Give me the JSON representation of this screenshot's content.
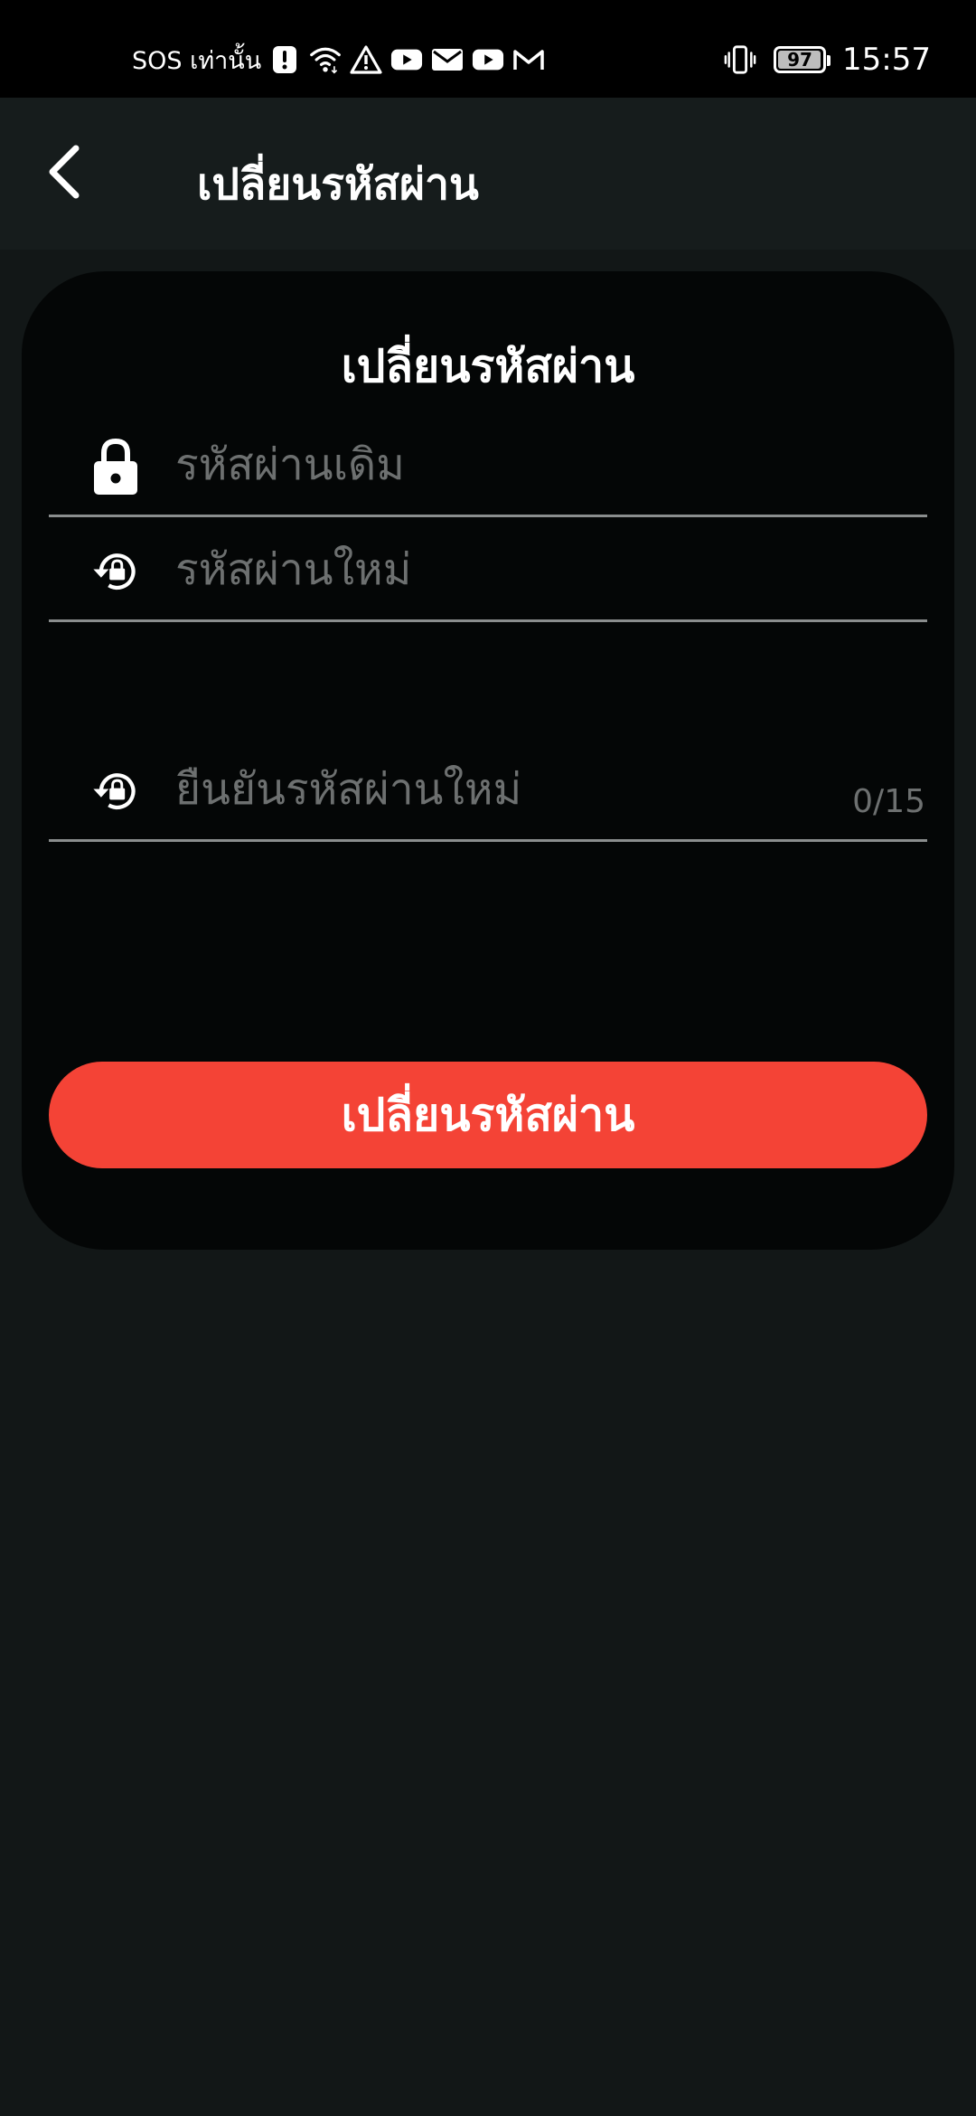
{
  "status_bar": {
    "carrier_text": "SOS เท่านั้น",
    "icons": [
      "alert-badge-icon",
      "wifi-icon",
      "warning-icon",
      "youtube-icon",
      "mail-icon",
      "youtube-icon",
      "gmail-icon"
    ],
    "vibrate_icon": "vibrate-icon",
    "battery_level": "97",
    "time": "15:57"
  },
  "header": {
    "back_icon": "chevron-left-icon",
    "title": "เปลี่ยนรหัสผ่าน"
  },
  "form": {
    "title": "เปลี่ยนรหัสผ่าน",
    "fields": [
      {
        "icon": "lock-icon",
        "placeholder": "รหัสผ่านเดิม",
        "value": ""
      },
      {
        "icon": "lock-reset-icon",
        "placeholder": "รหัสผ่านใหม่",
        "value": ""
      },
      {
        "icon": "lock-reset-icon",
        "placeholder": "ยืนยันรหัสผ่านใหม่",
        "value": ""
      }
    ],
    "new_password_counter": "0/15",
    "submit_label": "เปลี่ยนรหัสผ่าน"
  },
  "colors": {
    "accent": "#f44336",
    "background": "#121717",
    "card": "#040606",
    "status_bar": "#000000"
  }
}
